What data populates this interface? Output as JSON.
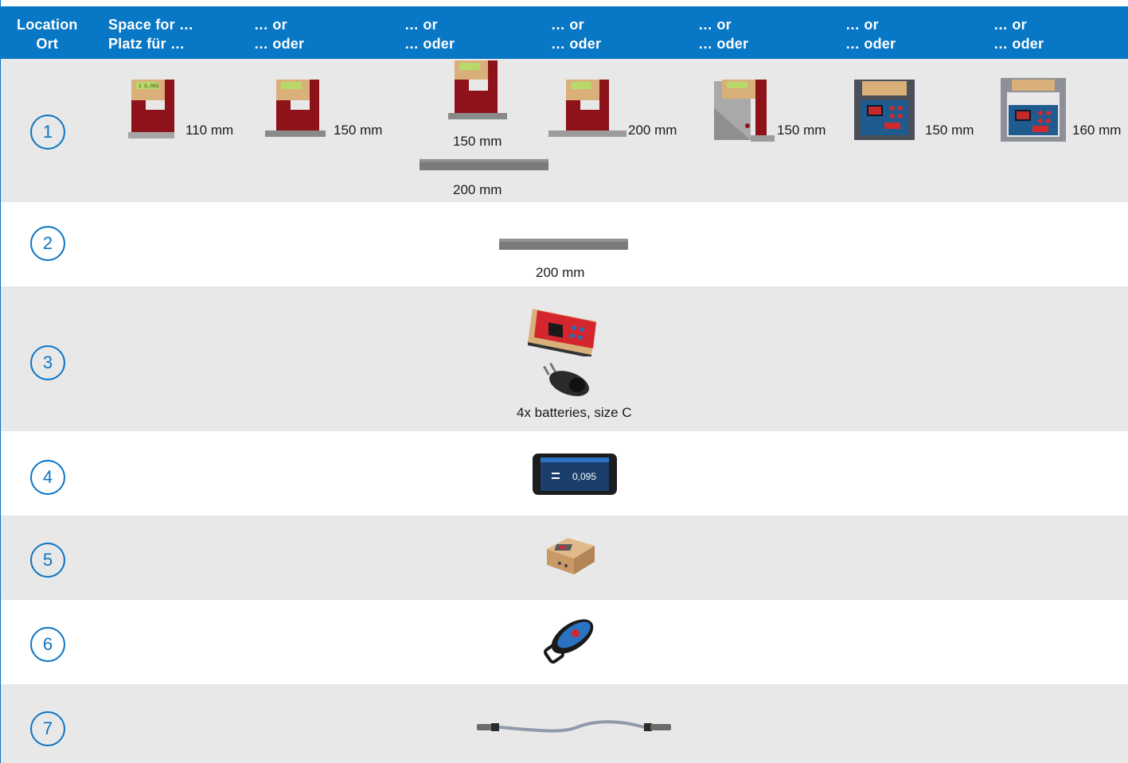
{
  "header": {
    "columns": [
      {
        "en": "Location",
        "de": "Ort"
      },
      {
        "en": "Space for …",
        "de": "Platz für …"
      },
      {
        "en": "… or",
        "de": "… oder"
      },
      {
        "en": "… or",
        "de": "… oder"
      },
      {
        "en": "… or",
        "de": "… oder"
      },
      {
        "en": "… or",
        "de": "… oder"
      },
      {
        "en": "… or",
        "de": "… oder"
      },
      {
        "en": "… or",
        "de": "… oder"
      }
    ]
  },
  "rows": [
    {
      "number": "1",
      "labels": [
        "110 mm",
        "150 mm",
        "150 mm",
        "200 mm",
        "200 mm",
        "150 mm",
        "150 mm",
        "160 mm"
      ],
      "display_reading": "1  0,095"
    },
    {
      "number": "2",
      "labels": [
        "200 mm"
      ]
    },
    {
      "number": "3",
      "labels": [
        "4x batteries, size C"
      ]
    },
    {
      "number": "4",
      "labels": [],
      "display_value": "0,095"
    },
    {
      "number": "5",
      "labels": []
    },
    {
      "number": "6",
      "labels": []
    },
    {
      "number": "7",
      "labels": []
    }
  ],
  "colors": {
    "header_blue": "#0877c5",
    "row_gray": "#e8e8e8",
    "badge_blue": "#0b74c4",
    "device_red": "#8e1219",
    "foot_gray": "#9a9a9a"
  }
}
